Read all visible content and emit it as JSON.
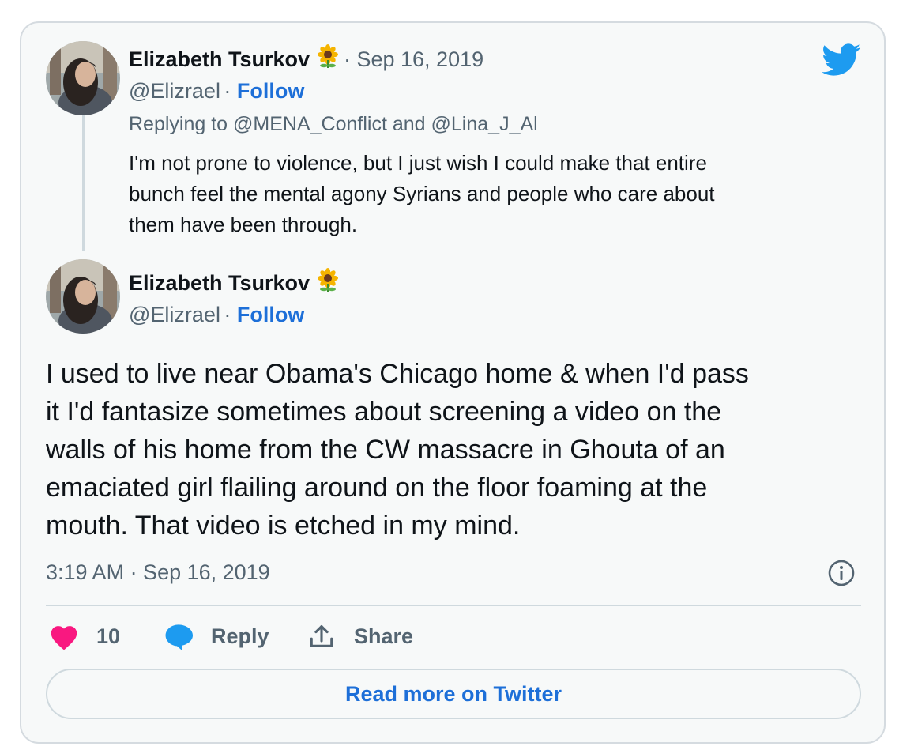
{
  "parent_tweet": {
    "author_name": "Elizabeth Tsurkov",
    "author_emoji": "sunflower-icon",
    "date": "Sep 16, 2019",
    "handle": "@Elizrael",
    "follow_label": "Follow",
    "replying_prefix": "Replying to ",
    "reply_handle_1": "@MENA_Conflict",
    "reply_and": " and ",
    "reply_handle_2": "@Lina_J_Al",
    "text_lines": [
      "I'm not prone to violence, but I just wish I could make that entire",
      "bunch feel the mental agony Syrians and people who care about",
      "them have been through."
    ]
  },
  "main_tweet": {
    "author_name": "Elizabeth Tsurkov",
    "author_emoji": "sunflower-icon",
    "handle": "@Elizrael",
    "follow_label": "Follow",
    "text_lines": [
      "I used to live near Obama's Chicago home & when I'd pass",
      "it I'd fantasize sometimes about screening a video on the",
      "walls of his home from the CW massacre in Ghouta of an",
      "emaciated girl flailing around on the floor foaming at the",
      "mouth. That video is etched in my mind."
    ],
    "timestamp": "3:19 AM · Sep 16, 2019"
  },
  "actions": {
    "like_count": "10",
    "reply_label": "Reply",
    "share_label": "Share"
  },
  "read_more_label": "Read more on Twitter",
  "colors": {
    "link": "#1d6fd8",
    "like": "#f91880",
    "twitter": "#1d9bf0",
    "muted": "#536471"
  }
}
